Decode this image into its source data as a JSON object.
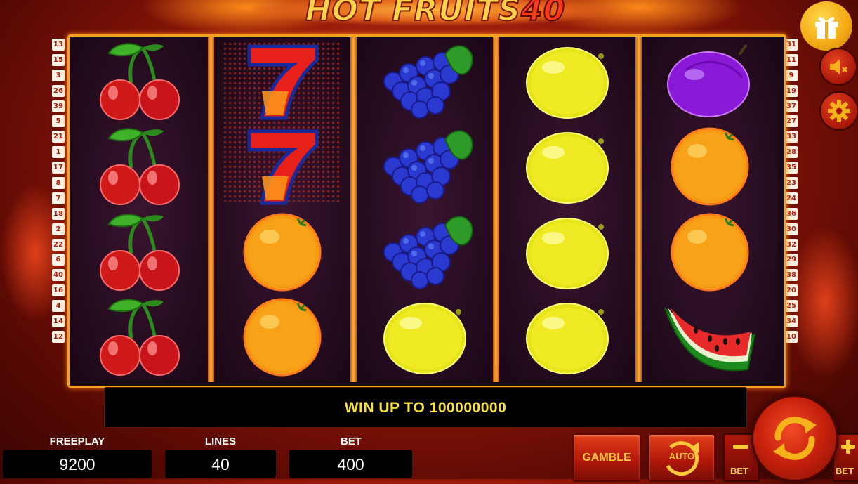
{
  "game": {
    "title_word": "HOT FRUITS",
    "title_number": "40"
  },
  "lines_left": [
    "13",
    "15",
    "3",
    "26",
    "39",
    "5",
    "21",
    "1",
    "17",
    "8",
    "7",
    "18",
    "2",
    "22",
    "6",
    "40",
    "16",
    "4",
    "14",
    "12"
  ],
  "lines_right": [
    "31",
    "11",
    "9",
    "19",
    "37",
    "27",
    "33",
    "28",
    "35",
    "23",
    "24",
    "36",
    "30",
    "32",
    "29",
    "38",
    "20",
    "25",
    "34",
    "10"
  ],
  "reels": [
    [
      "cherry-icon",
      "cherry-icon",
      "cherry-icon",
      "cherry-icon"
    ],
    [
      "seven-icon",
      "seven-icon",
      "orange-icon",
      "orange-icon"
    ],
    [
      "grape-icon",
      "grape-icon",
      "grape-icon",
      "lemon-icon"
    ],
    [
      "lemon-icon",
      "lemon-icon",
      "lemon-icon",
      "lemon-icon"
    ],
    [
      "plum-icon",
      "orange-icon",
      "orange-icon",
      "watermelon-icon"
    ]
  ],
  "message": "WIN UP TO 100000000",
  "stats": {
    "freeplay_label": "FREEPLAY",
    "freeplay_value": "9200",
    "lines_label": "LINES",
    "lines_value": "40",
    "bet_label": "BET",
    "bet_value": "400"
  },
  "buttons": {
    "gamble": "GAMBLE",
    "auto": "AUTO",
    "bet_minus": "BET",
    "bet_plus": "BET"
  },
  "colors": {
    "frame": "#f2a21e",
    "message_text": "#f6e23a",
    "button_text": "#ffc93a",
    "gift": "#f3a814"
  }
}
